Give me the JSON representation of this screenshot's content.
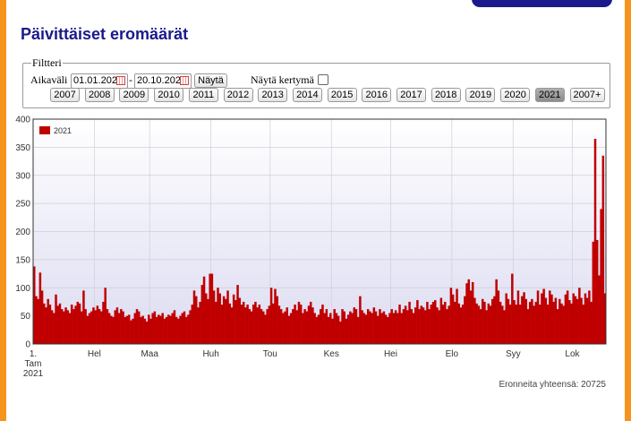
{
  "page": {
    "title": "Päivittäiset eromäärät",
    "total_label": "Eronneita yhteensä: 20725"
  },
  "filters": {
    "legend": "Filtteri",
    "range_label": "Aikaväli",
    "from_value": "01.01.202",
    "separator": "-",
    "to_value": "20.10.202",
    "show_button": "Näytä",
    "cumulative_label": "Näytä kertymä",
    "years": [
      "2007",
      "2008",
      "2009",
      "2010",
      "2011",
      "2012",
      "2013",
      "2014",
      "2015",
      "2016",
      "2017",
      "2018",
      "2019",
      "2020",
      "2021",
      "2007+"
    ],
    "selected_year": "2021"
  },
  "colors": {
    "background": "#f7941d",
    "title": "#1a1a8c",
    "bar": "#c00000",
    "plot_gradient_top": "#ffffff",
    "plot_gradient_bottom": "#dcdcf2"
  },
  "chart_data": {
    "type": "bar",
    "ylim": [
      0,
      400
    ],
    "yticks": [
      0,
      50,
      100,
      150,
      200,
      250,
      300,
      350,
      400
    ],
    "xticks": [
      {
        "day": 1,
        "label": "1.",
        "sub": [
          "Tam",
          "2021"
        ]
      },
      {
        "day": 32,
        "label": "Hel"
      },
      {
        "day": 60,
        "label": "Maa"
      },
      {
        "day": 91,
        "label": "Huh"
      },
      {
        "day": 121,
        "label": "Tou"
      },
      {
        "day": 152,
        "label": "Kes"
      },
      {
        "day": 182,
        "label": "Hei"
      },
      {
        "day": 213,
        "label": "Elo"
      },
      {
        "day": 244,
        "label": "Syy"
      },
      {
        "day": 274,
        "label": "Lok"
      }
    ],
    "series": [
      {
        "name": "2021",
        "values": [
          138,
          85,
          80,
          127,
          95,
          72,
          65,
          80,
          70,
          60,
          55,
          88,
          68,
          72,
          62,
          58,
          65,
          60,
          55,
          70,
          62,
          68,
          75,
          72,
          58,
          95,
          62,
          50,
          55,
          58,
          65,
          60,
          68,
          62,
          58,
          75,
          100,
          62,
          55,
          50,
          48,
          60,
          65,
          55,
          62,
          58,
          48,
          50,
          52,
          42,
          45,
          55,
          62,
          58,
          48,
          50,
          45,
          40,
          52,
          45,
          55,
          58,
          48,
          52,
          50,
          55,
          45,
          48,
          52,
          50,
          55,
          60,
          48,
          45,
          50,
          55,
          58,
          48,
          52,
          60,
          70,
          95,
          85,
          65,
          75,
          105,
          120,
          90,
          80,
          125,
          125,
          95,
          75,
          100,
          90,
          70,
          85,
          80,
          95,
          72,
          65,
          88,
          78,
          105,
          82,
          70,
          75,
          65,
          70,
          62,
          58,
          70,
          75,
          65,
          70,
          62,
          58,
          52,
          62,
          68,
          100,
          72,
          98,
          85,
          68,
          62,
          55,
          58,
          65,
          50,
          55,
          62,
          70,
          60,
          75,
          70,
          55,
          62,
          58,
          68,
          75,
          65,
          55,
          48,
          52,
          62,
          70,
          55,
          62,
          48,
          55,
          45,
          62,
          55,
          50,
          40,
          62,
          58,
          45,
          52,
          58,
          55,
          65,
          62,
          48,
          85,
          60,
          55,
          52,
          62,
          58,
          55,
          65,
          58,
          50,
          62,
          55,
          58,
          52,
          48,
          55,
          62,
          55,
          60,
          55,
          70,
          55,
          62,
          68,
          60,
          75,
          62,
          55,
          65,
          78,
          62,
          68,
          65,
          60,
          75,
          62,
          70,
          75,
          78,
          65,
          60,
          82,
          70,
          75,
          62,
          68,
          100,
          88,
          75,
          98,
          72,
          65,
          70,
          85,
          108,
          115,
          95,
          110,
          82,
          72,
          68,
          62,
          80,
          75,
          60,
          72,
          68,
          80,
          85,
          115,
          95,
          75,
          68,
          60,
          90,
          80,
          70,
          125,
          78,
          70,
          95,
          70,
          85,
          92,
          80,
          62,
          75,
          80,
          68,
          75,
          95,
          70,
          90,
          98,
          82,
          70,
          95,
          88,
          75,
          82,
          62,
          80,
          72,
          68,
          88,
          95,
          78,
          72,
          90,
          85,
          80,
          100,
          82,
          70,
          90,
          82,
          95,
          75,
          182,
          365,
          185,
          122,
          240,
          335,
          90
        ]
      }
    ]
  }
}
